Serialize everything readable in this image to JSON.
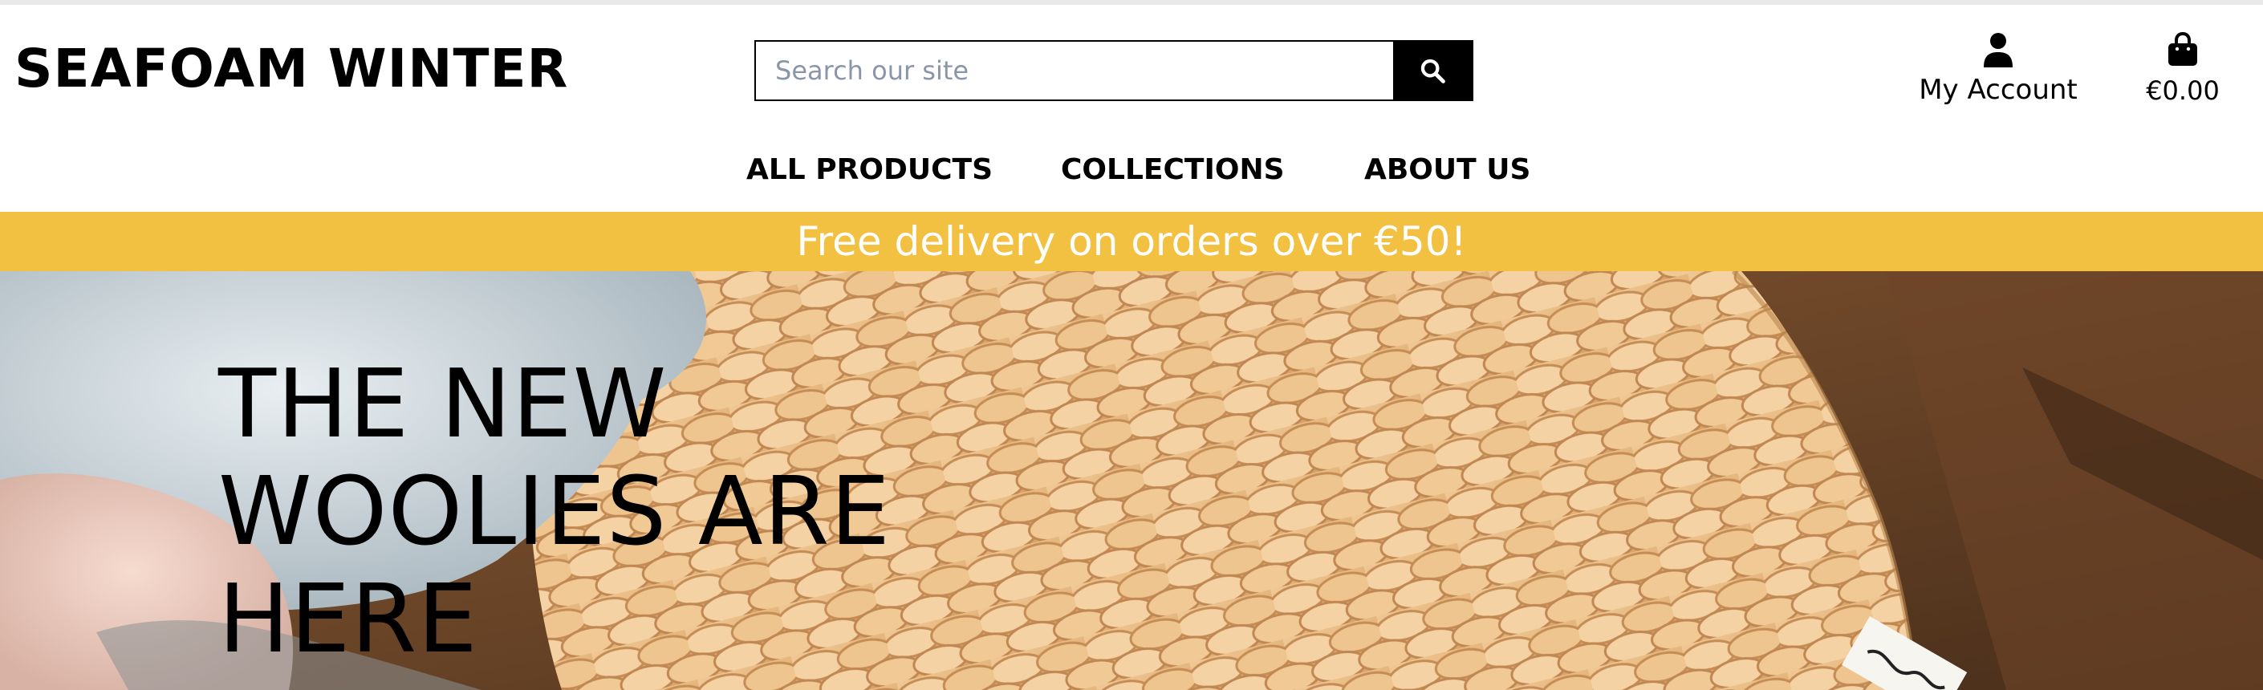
{
  "brand": {
    "name": "SEAFOAM WINTER"
  },
  "search": {
    "placeholder": "Search our site",
    "value": "",
    "button_icon": "search-icon"
  },
  "account": {
    "label": "My Account",
    "icon": "user-icon"
  },
  "cart": {
    "total": "€0.00",
    "icon": "shopping-bag-icon"
  },
  "nav": {
    "items": [
      {
        "label": "ALL PRODUCTS"
      },
      {
        "label": "COLLECTIONS"
      },
      {
        "label": "ABOUT US"
      }
    ]
  },
  "promo": {
    "text": "Free delivery on orders over €50!"
  },
  "hero": {
    "title": "THE NEW WOOLIES ARE HERE"
  },
  "colors": {
    "promo_bg": "#f2c141",
    "promo_text": "#ffffff",
    "accent": "#000000"
  }
}
